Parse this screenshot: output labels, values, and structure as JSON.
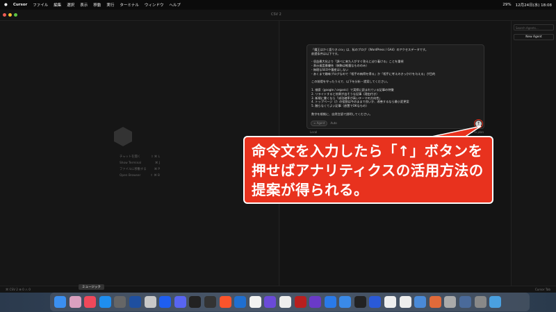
{
  "menubar": {
    "app": "Cursor",
    "items": [
      "ファイル",
      "編集",
      "選択",
      "表示",
      "移動",
      "実行",
      "ターミナル",
      "ウィンドウ",
      "ヘルプ"
    ],
    "battery": "29%",
    "datetime": "12月24日(水)  18:08"
  },
  "window": {
    "title": "CSV 2"
  },
  "welcome": {
    "shortcuts": [
      {
        "label": "チャットを開く",
        "keys": "⇧ ⌘ L"
      },
      {
        "label": "Show Terminal",
        "keys": "⌘ J"
      },
      {
        "label": "ファイルに移動する",
        "keys": "⌘ P"
      },
      {
        "label": "Open Browser",
        "keys": "⇧ ⌘ B"
      }
    ]
  },
  "sidebar": {
    "search_placeholder": "Search Agents...",
    "new_agent": "New Agent"
  },
  "chat": {
    "lines": [
      "「魔王はかく語りき.csv」は、私のブログ（WordPress / GA4）のアクセスデータです。",
      "前提条件は以下です。",
      "",
      "- 収益最大化より「調べに来た人がすぐ答えに辿り着ける」ことを重視",
      "- 表示速度最優先（装飾は軽量なもののみ）",
      "- 無理なSEOや量産はしない",
      "- あくまで趣味ブログなので「相手の納得を得る」か「相手に考えのきっかけを与える」が目的",
      "",
      "この前提を守ったうえで、以下を分析・提案してください。",
      "",
      "1. 検索（google / organic）で実際に読まれている記事の特徴",
      "2. リライトすると効果が出そうな記事（理由付き）",
      "3. 新規に書くなら「成功確率が高いテーマの方向性」",
      "4. トップページ（/）の役割は今のままで良いか、改善するなら最小変更案",
      "5. 触らなくてよい記事（放置でOKなもの）",
      "",
      "数字を根拠に、自然言語で説明してください。"
    ],
    "mode": "∞ Agent",
    "model": "Auto",
    "send": "↑",
    "location": "Local",
    "hint_keys": "Shift  Tab",
    "hint": "to plan"
  },
  "callout": {
    "text": "命令文を入力したら「↑」ボタンを押せばアナリティクスの活用方法の提案が得られる。"
  },
  "status": {
    "left": "⌘ CSV 2  ⊗ 0 ⚠ 0",
    "right": "Cursor Tab"
  },
  "dock": {
    "tooltip": "ミュージック",
    "colors": [
      "#3b8ff0",
      "#d9a0c0",
      "#f0485a",
      "#1e8ef0",
      "#666",
      "#1e4fa0",
      "#c8c8c8",
      "#1e5ef0",
      "#5865f2",
      "#222",
      "#333",
      "#fb542b",
      "#1f6fd0",
      "#f2f2f2",
      "#6a4ad8",
      "#eee",
      "#b81f1f",
      "#6a3ac8",
      "#2a7ae8",
      "#3a8ae8",
      "#222",
      "#2a5ad8",
      "#eee",
      "#eee",
      "#4a8ad8",
      "#e06a3a",
      "#aaa",
      "#4a6a9a",
      "#888",
      "#4aa0e0"
    ]
  }
}
